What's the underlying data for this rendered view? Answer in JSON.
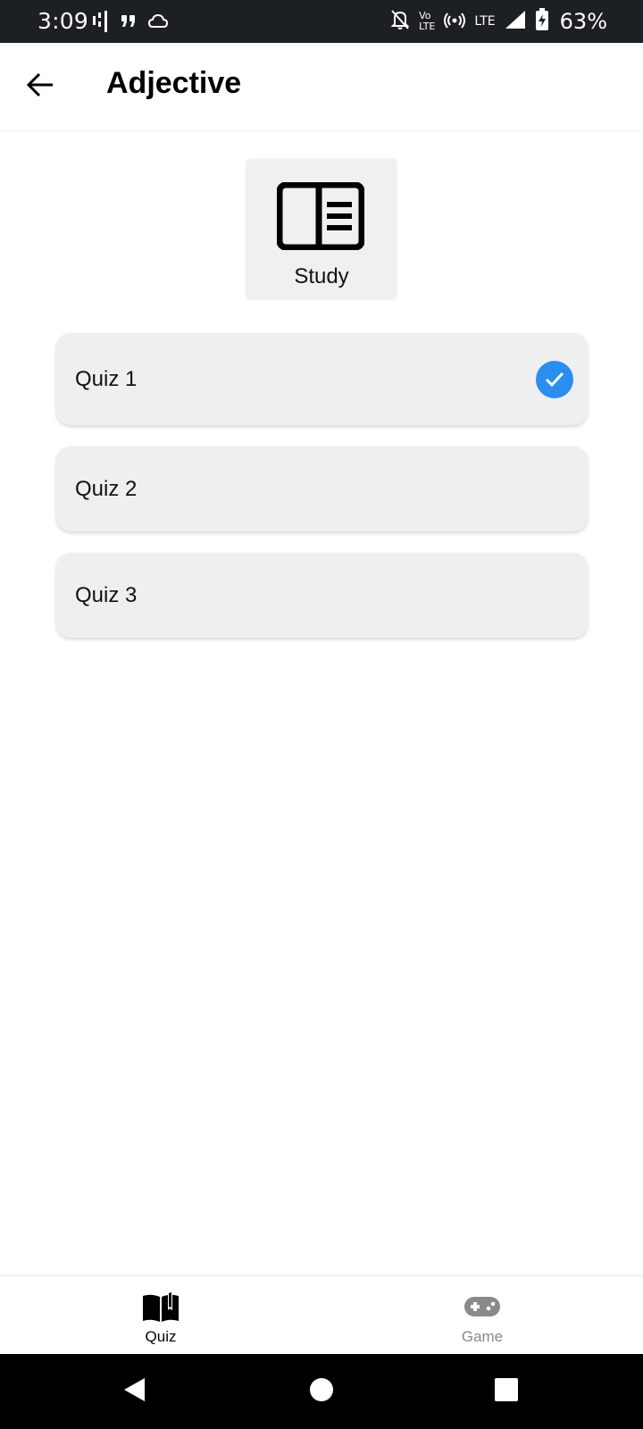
{
  "status_bar": {
    "time": "3:09",
    "volte_top": "Vo",
    "volte_bottom": "LTE",
    "lte": "LTE",
    "battery": "63%",
    "icons": [
      "signal-bars-icon",
      "quote-icon",
      "cloud-icon",
      "bell-off-icon",
      "volte-icon",
      "hotspot-icon",
      "lte-icon",
      "cell-signal-icon",
      "battery-charging-icon"
    ]
  },
  "app_bar": {
    "title": "Adjective",
    "back_icon": "arrow-back-icon"
  },
  "study": {
    "label": "Study",
    "icon": "book-page-icon"
  },
  "quizzes": [
    {
      "label": "Quiz 1",
      "completed": true
    },
    {
      "label": "Quiz 2",
      "completed": false
    },
    {
      "label": "Quiz 3",
      "completed": false
    }
  ],
  "bottom_nav": {
    "tabs": [
      {
        "label": "Quiz",
        "icon": "open-book-icon",
        "active": true
      },
      {
        "label": "Game",
        "icon": "gamepad-icon",
        "active": false
      }
    ]
  },
  "system_nav": {
    "icons": [
      "back-triangle-icon",
      "home-circle-icon",
      "recents-square-icon"
    ]
  },
  "colors": {
    "status_bar": "#1c1f24",
    "accent_check": "#2a8ef0",
    "card_bg": "#efefef",
    "nav_active": "#000000",
    "nav_inactive": "#8a8a8a"
  }
}
